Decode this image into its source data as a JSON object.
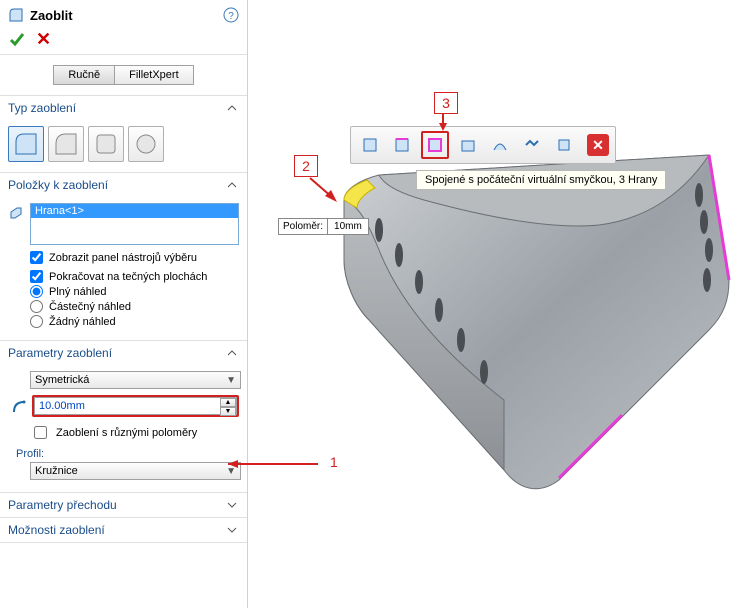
{
  "feature": {
    "name": "Zaoblit",
    "help_tooltip": "Nápověda"
  },
  "tabs": {
    "manual": "Ručně",
    "expert": "FilletXpert"
  },
  "sections": {
    "type": {
      "title": "Typ zaoblení"
    },
    "items": {
      "title": "Položky k zaoblení",
      "selection": [
        "Hrana<1>"
      ],
      "show_toolbar": {
        "label": "Zobrazit panel nástrojů výběru",
        "checked": true
      },
      "tangent": {
        "label": "Pokračovat na tečných plochách",
        "checked": true
      },
      "preview_full": {
        "label": "Plný náhled",
        "selected": true
      },
      "preview_partial": {
        "label": "Částečný náhled",
        "selected": false
      },
      "preview_none": {
        "label": "Žádný náhled",
        "selected": false
      }
    },
    "params": {
      "title": "Parametry zaoblení",
      "symmetry_options": [
        "Symetrická"
      ],
      "symmetry_value": "Symetrická",
      "radius_value": "10.00mm",
      "multi_radius": {
        "label": "Zaoblení s různými poloměry",
        "checked": false
      }
    },
    "profile": {
      "title": "Profil:",
      "options": [
        "Kružnice"
      ],
      "value": "Kružnice"
    },
    "transition": {
      "title": "Parametry přechodu"
    },
    "options": {
      "title": "Možnosti zaoblení"
    }
  },
  "context_toolbar": {
    "icons": [
      "select-edge-icon",
      "select-edge-loop-icon",
      "select-virtual-loop-icon",
      "select-face-icon",
      "select-tangent-icon",
      "select-chain-icon",
      "select-body-icon"
    ],
    "highlight_index": 2,
    "tooltip": "Spojené s počáteční virtuální smyčkou, 3 Hrany"
  },
  "radius_callout": {
    "label": "Poloměr:",
    "value": "10mm"
  },
  "annotations": {
    "n1": "1",
    "n2": "2",
    "n3": "3"
  }
}
